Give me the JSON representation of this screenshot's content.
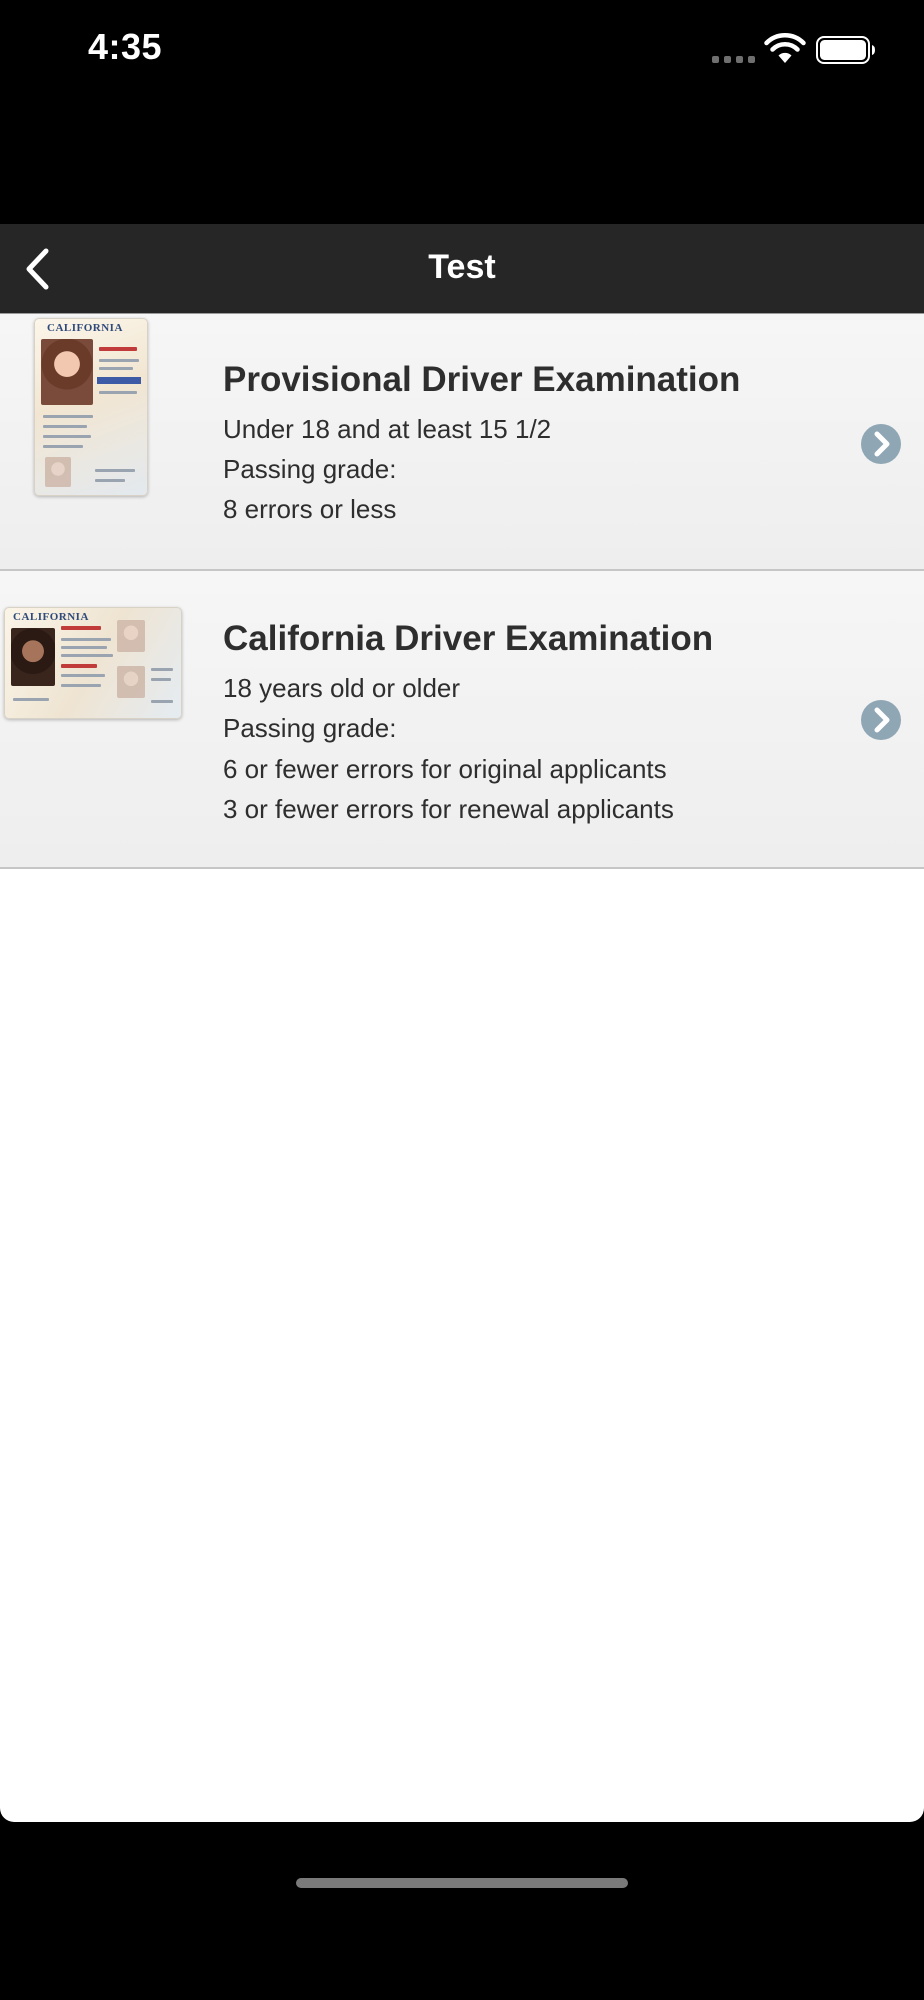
{
  "status_bar": {
    "time": "4:35",
    "wifi_icon": "wifi-icon",
    "battery_icon": "battery-icon"
  },
  "nav": {
    "title": "Test",
    "back_icon": "chevron-left-icon"
  },
  "tests": [
    {
      "title": "Provisional Driver Examination",
      "lines": [
        "Under 18 and at least 15 1/2",
        "Passing grade:",
        "8 errors or less"
      ],
      "thumbnail_text": "CALIFORNIA",
      "icon": "chevron-right-circle-icon"
    },
    {
      "title": "California Driver Examination",
      "lines": [
        "18 years old or older",
        "Passing grade:",
        "6 or fewer errors for original applicants",
        "3 or fewer errors for renewal applicants"
      ],
      "thumbnail_text": "CALIFORNIA",
      "icon": "chevron-right-circle-icon"
    }
  ],
  "colors": {
    "nav_background": "#262626",
    "item_background": "#f2f2f2",
    "chevron": "#8fa6b4",
    "text": "#2e2e2e"
  }
}
